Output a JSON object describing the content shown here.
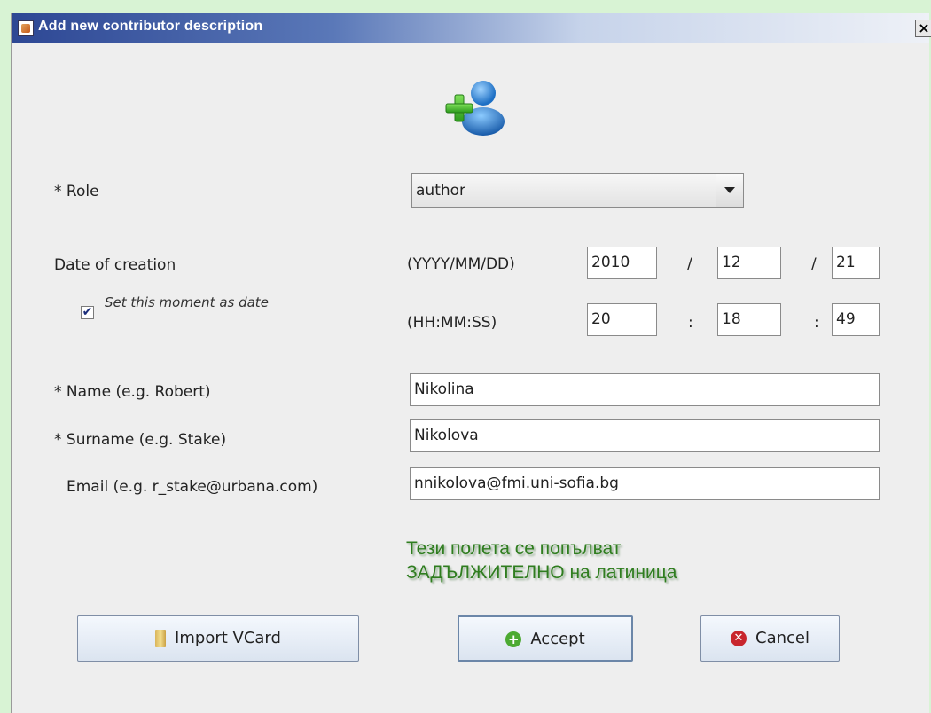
{
  "window": {
    "title": "Add new contributor description",
    "close_glyph": "×"
  },
  "header": {
    "icon": "add-user-icon"
  },
  "role": {
    "label": "* Role",
    "selected": "author"
  },
  "date": {
    "label": "Date of creation",
    "checkbox_label": "Set this moment as date",
    "checkbox_checked": true,
    "checkbox_glyph": "✔",
    "date_format": "(YYYY/MM/DD)",
    "year": "2010",
    "month": "12",
    "day": "21",
    "date_sep": "/",
    "time_format": "(HH:MM:SS)",
    "hour": "20",
    "minute": "18",
    "second": "49",
    "time_sep": ":"
  },
  "name": {
    "label": "* Name (e.g. Robert)",
    "value": "Nikolina"
  },
  "surname": {
    "label": "* Surname (e.g. Stake)",
    "value": "Nikolova"
  },
  "email": {
    "label": "Email (e.g. r_stake@urbana.com)",
    "value": "nnikolova@fmi.uni-sofia.bg"
  },
  "note": {
    "line1": "Тези полета се попълват",
    "line2": "ЗАДЪЛЖИТЕЛНО на латиница",
    "color": "#2f7d1f"
  },
  "buttons": {
    "import": "Import VCard",
    "accept": "Accept",
    "cancel": "Cancel"
  }
}
